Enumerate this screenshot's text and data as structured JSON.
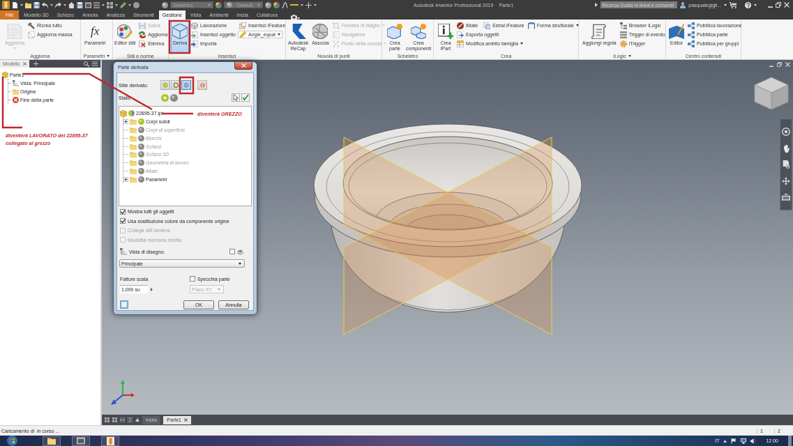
{
  "title_bar": {
    "style_select": "Generico",
    "appearance_select": "Default",
    "title": "Autodesk Inventor Professional 2019",
    "document": "Parte1",
    "search": {
      "placeholder": "Ricerca Guida in linea e comandi"
    },
    "user": "pasqualegigli..."
  },
  "tabs": [
    {
      "label": "File",
      "kind": "file",
      "selected": false
    },
    {
      "label": "Modello 3D",
      "kind": "tab",
      "selected": false
    },
    {
      "label": "Schizzo",
      "kind": "tab",
      "selected": false
    },
    {
      "label": "Annota",
      "kind": "tab",
      "selected": false
    },
    {
      "label": "Analizza",
      "kind": "tab",
      "selected": false
    },
    {
      "label": "Strumenti",
      "kind": "tab",
      "selected": false
    },
    {
      "label": "Gestione",
      "kind": "tab",
      "selected": true
    },
    {
      "label": "Vista",
      "kind": "tab",
      "selected": false
    },
    {
      "label": "Ambienti",
      "kind": "tab",
      "selected": false
    },
    {
      "label": "Inizia",
      "kind": "tab",
      "selected": false
    },
    {
      "label": "Collabora",
      "kind": "tab",
      "selected": false
    }
  ],
  "ribbon": [
    {
      "title": "Aggiorna",
      "menu": false,
      "groups": [
        [
          [
            {
              "label": "Aggiorna",
              "kind": "large",
              "disabled": true,
              "pressed": false,
              "dropdown": true
            }
          ]
        ],
        [
          [
            {
              "label": "Ricrea tutto",
              "kind": "small",
              "disabled": false,
              "pressed": false,
              "dropdown": false
            }
          ],
          [
            {
              "label": "Aggiorna massa",
              "kind": "small",
              "disabled": false,
              "pressed": false,
              "dropdown": false
            }
          ]
        ]
      ]
    },
    {
      "title": "Parametri",
      "menu": true,
      "groups": [
        [
          [
            {
              "label": "Parametri",
              "kind": "large",
              "glyph": "fx",
              "disabled": false,
              "pressed": false,
              "dropdown": false
            }
          ]
        ]
      ]
    },
    {
      "title": "Stili e norme",
      "menu": false,
      "groups": [
        [
          [
            {
              "label": "Editor stili",
              "kind": "large",
              "disabled": false,
              "pressed": false,
              "dropdown": false
            }
          ]
        ],
        [
          [
            {
              "label": "Salva",
              "kind": "small",
              "disabled": true,
              "pressed": false,
              "dropdown": false
            }
          ],
          [
            {
              "label": "Aggiorna",
              "kind": "small",
              "disabled": false,
              "pressed": false,
              "dropdown": false
            }
          ],
          [
            {
              "label": "Elimina",
              "kind": "small",
              "disabled": false,
              "pressed": false,
              "dropdown": false
            }
          ]
        ]
      ]
    },
    {
      "title": "Inserisci",
      "menu": false,
      "groups": [
        [
          [
            {
              "label": "Deriva",
              "kind": "large",
              "disabled": false,
              "pressed": true,
              "dropdown": false
            }
          ]
        ],
        [
          [
            {
              "label": "Lavorazione",
              "kind": "small",
              "disabled": false,
              "pressed": false,
              "dropdown": false
            }
          ],
          [
            {
              "label": "Inserisci oggetto",
              "kind": "small",
              "disabled": false,
              "pressed": false,
              "dropdown": false
            }
          ],
          [
            {
              "label": "Importa",
              "kind": "small",
              "disabled": false,
              "pressed": false,
              "dropdown": false
            }
          ]
        ],
        [
          [
            {
              "label": "Inserisci iFeature",
              "kind": "small",
              "disabled": false,
              "pressed": false,
              "dropdown": false
            }
          ],
          [
            {
              "label": "Angle_equal",
              "kind": "combo",
              "disabled": false,
              "pressed": false,
              "dropdown": true
            }
          ]
        ]
      ]
    },
    {
      "title": "Nuvola di punti",
      "menu": false,
      "groups": [
        [
          [
            {
              "label": "Autodesk\nReCap",
              "kind": "large",
              "disabled": false,
              "pressed": false,
              "dropdown": false
            }
          ]
        ],
        [
          [
            {
              "label": "Associa",
              "kind": "large",
              "disabled": false,
              "pressed": false,
              "dropdown": false
            }
          ]
        ],
        [
          [
            {
              "label": "Finestra di ritaglio",
              "kind": "small",
              "disabled": true,
              "pressed": false,
              "dropdown": true
            }
          ],
          [
            {
              "label": "Navigatore",
              "kind": "small",
              "disabled": true,
              "pressed": false,
              "dropdown": false
            }
          ],
          [
            {
              "label": "Punto della nuvola",
              "kind": "small",
              "disabled": true,
              "pressed": false,
              "dropdown": true
            }
          ]
        ]
      ]
    },
    {
      "title": "Scheletro",
      "menu": false,
      "groups": [
        [
          [
            {
              "label": "Crea\nparte",
              "kind": "large",
              "disabled": false,
              "pressed": false,
              "dropdown": false
            }
          ]
        ],
        [
          [
            {
              "label": "Crea\ncomponenti",
              "kind": "large",
              "disabled": false,
              "pressed": false,
              "dropdown": false
            }
          ]
        ]
      ]
    },
    {
      "title": "Crea",
      "menu": false,
      "groups": [
        [
          [
            {
              "label": "Crea\niPart",
              "kind": "large",
              "disabled": false,
              "pressed": false,
              "dropdown": false
            }
          ]
        ],
        [
          [
            {
              "label": "iMate",
              "kind": "small",
              "disabled": false,
              "pressed": false,
              "dropdown": false
            },
            {
              "label": "Estrai iFeature",
              "kind": "small",
              "disabled": false,
              "pressed": false,
              "dropdown": false
            }
          ],
          [
            {
              "label": "Esporta oggetti",
              "kind": "small",
              "disabled": false,
              "pressed": false,
              "dropdown": false
            }
          ],
          [
            {
              "label": "Modifica ambito famiglia",
              "kind": "small",
              "disabled": false,
              "pressed": false,
              "dropdown": true
            }
          ]
        ],
        [
          [
            {
              "label": "Forma strutturale",
              "kind": "small",
              "disabled": false,
              "pressed": false,
              "dropdown": true
            }
          ]
        ]
      ]
    },
    {
      "title": "iLogic",
      "menu": true,
      "groups": [
        [
          [
            {
              "label": "Aggiungi regola",
              "kind": "large",
              "disabled": false,
              "pressed": false,
              "dropdown": false
            }
          ]
        ],
        [
          [
            {
              "label": "Browser iLogic",
              "kind": "small",
              "disabled": false,
              "pressed": false,
              "dropdown": false
            }
          ],
          [
            {
              "label": "Trigger di evento",
              "kind": "small",
              "disabled": false,
              "pressed": false,
              "dropdown": false
            }
          ],
          [
            {
              "label": "iTrigger",
              "kind": "small",
              "disabled": false,
              "pressed": false,
              "dropdown": false
            }
          ]
        ]
      ]
    },
    {
      "title": "Centro contenuti",
      "menu": false,
      "groups": [
        [
          [
            {
              "label": "Editor",
              "kind": "large",
              "disabled": false,
              "pressed": false,
              "dropdown": false
            }
          ]
        ],
        [
          [
            {
              "label": "Pubblica lavorazione",
              "kind": "small",
              "disabled": false,
              "pressed": false,
              "dropdown": false
            }
          ],
          [
            {
              "label": "Pubblica parte",
              "kind": "small",
              "disabled": false,
              "pressed": false,
              "dropdown": false
            }
          ],
          [
            {
              "label": "Pubblica per gruppi",
              "kind": "small",
              "disabled": false,
              "pressed": false,
              "dropdown": false
            }
          ]
        ]
      ]
    }
  ],
  "browser": {
    "tab": "Modello",
    "tree": {
      "label": "Parte1",
      "children": [
        {
          "label": "Vista: Principale"
        },
        {
          "label": "Origine"
        },
        {
          "label": "Fine della parte"
        }
      ]
    }
  },
  "dialog": {
    "title": "Parte derivata",
    "style_label": "Stile derivato:",
    "styles": [
      {
        "selected": false
      },
      {
        "selected": false
      },
      {
        "selected": true
      },
      {
        "selected": false
      }
    ],
    "status_label": "Stato:",
    "tree": {
      "label": "22895-37.ipt",
      "partial": true,
      "children": [
        {
          "label": "Corpi solidi",
          "expandable": true,
          "included": true,
          "disabled": false
        },
        {
          "label": "Corpi di superficie",
          "expandable": false,
          "included": false,
          "disabled": true
        },
        {
          "label": "Blocchi",
          "expandable": false,
          "included": false,
          "disabled": true
        },
        {
          "label": "Schizzi",
          "expandable": false,
          "included": false,
          "disabled": true
        },
        {
          "label": "Schizzi 3D",
          "expandable": false,
          "included": false,
          "disabled": true
        },
        {
          "label": "Geometria di lavoro",
          "expandable": false,
          "included": false,
          "disabled": true
        },
        {
          "label": "iMate",
          "expandable": false,
          "included": false,
          "disabled": true
        },
        {
          "label": "Parametri",
          "expandable": true,
          "included": false,
          "disabled": false
        }
      ]
    },
    "options": [
      {
        "label": "Mostra tutti gli oggetti",
        "checked": true,
        "disabled": false
      },
      {
        "label": "Usa sostituzione colore da componente origine",
        "checked": true,
        "disabled": false
      },
      {
        "label": "Collega stili lamiera",
        "checked": false,
        "disabled": true
      },
      {
        "label": "Modalità memoria ridotta",
        "checked": false,
        "disabled": true
      }
    ],
    "view_label": "Vista di disegno:",
    "view_checkbox": {
      "checked": false
    },
    "view_select": "Principale",
    "scale_label": "Fattore scala",
    "scale_value": "1,000 su",
    "mirror": {
      "label": "Specchia parte",
      "checked": false
    },
    "plane_select": {
      "value": "Piano XY",
      "disabled": true
    },
    "buttons": [
      "OK",
      "Annulla"
    ]
  },
  "annotations": [
    {
      "text": "diventerà LAVORATO del 22895-37\ncollegato al grezzo"
    },
    {
      "text": "diventerà GREZZO"
    }
  ],
  "document_tabs": [
    {
      "label": "Inizio",
      "selected": false,
      "closable": false
    },
    {
      "label": "Parte1",
      "selected": true,
      "closable": true
    }
  ],
  "status_bar": {
    "message": "Caricamento di  in corso ...",
    "counts": [
      "1",
      "2"
    ]
  },
  "taskbar": {
    "language": "IT",
    "clock": "12:00"
  }
}
